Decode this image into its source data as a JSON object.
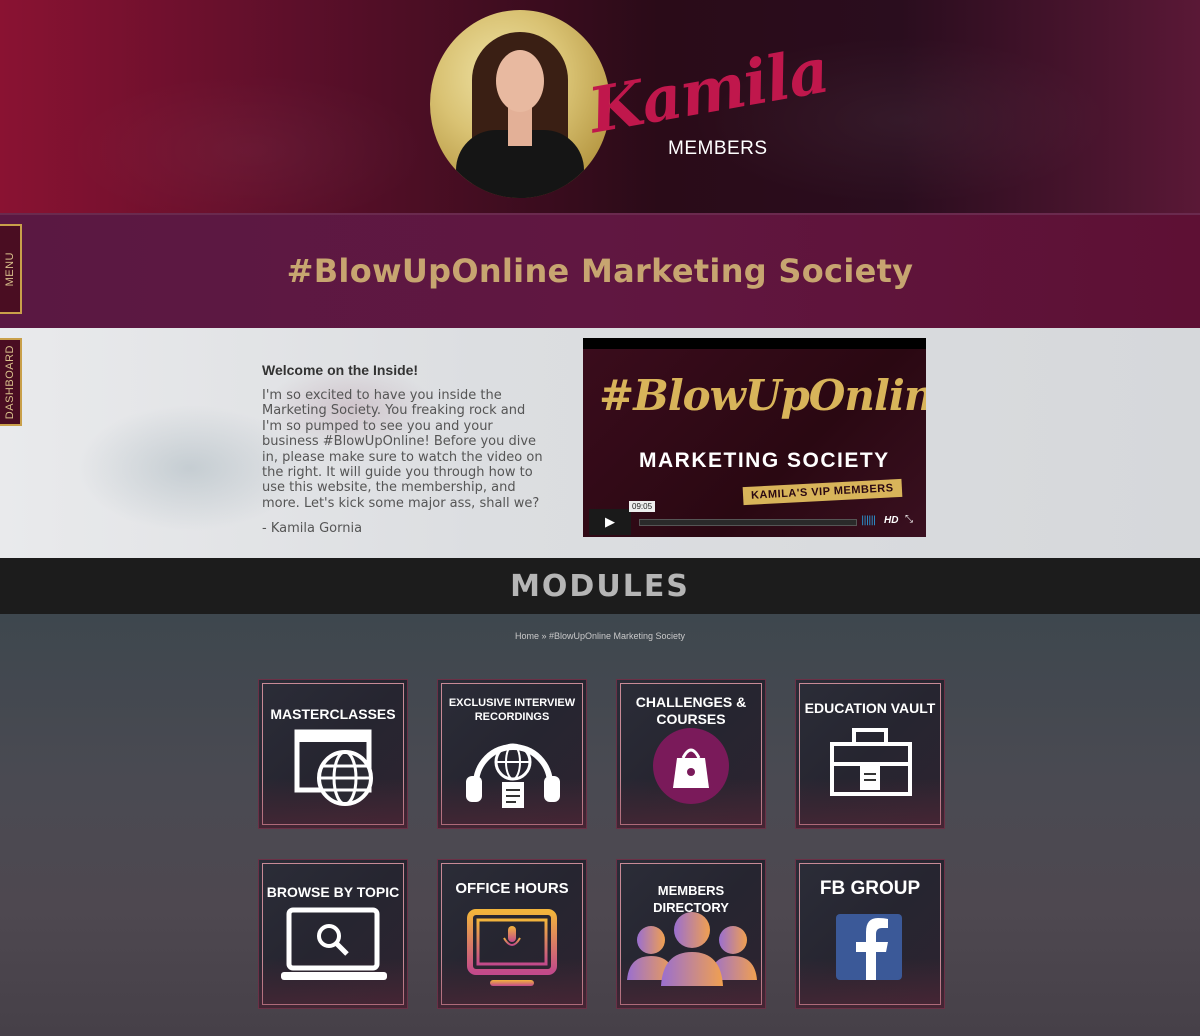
{
  "header": {
    "brand_script": "Kamila",
    "brand_sub": "MEMBERS"
  },
  "title_band": {
    "title": "#BlowUpOnline Marketing Society"
  },
  "side_tabs": {
    "menu": "MENU",
    "dashboard": "DASHBOARD"
  },
  "welcome": {
    "heading": "Welcome on the Inside!",
    "body": "I'm so excited to have you inside the Marketing Society. You freaking rock and I'm so pumped to see you and your business #BlowUpOnline! Before you dive in, please make sure to watch the video on the right. It will guide you through how to use this website, the membership, and more. Let's kick some major ass, shall we?",
    "signature": "- Kamila Gornia"
  },
  "video": {
    "script_title": "#BlowUpOnline",
    "subtitle": "MARKETING SOCIETY",
    "badge": "KAMILA'S VIP MEMBERS",
    "duration": "09:05",
    "hd_label": "HD"
  },
  "modules": {
    "title": "MODULES",
    "breadcrumb": "Home » #BlowUpOnline Marketing Society",
    "tiles": [
      {
        "label": "MASTERCLASSES",
        "icon": "browser-globe-icon"
      },
      {
        "label": "EXCLUSIVE INTERVIEW RECORDINGS",
        "icon": "headphones-globe-icon"
      },
      {
        "label": "CHALLENGES & COURSES",
        "icon": "shopping-bag-icon"
      },
      {
        "label": "EDUCATION VAULT",
        "icon": "briefcase-icon"
      },
      {
        "label": "BROWSE BY TOPIC",
        "icon": "laptop-search-icon"
      },
      {
        "label": "OFFICE HOURS",
        "icon": "monitor-microphone-icon"
      },
      {
        "label": "MEMBERS DIRECTORY",
        "icon": "people-group-icon"
      },
      {
        "label": "FB GROUP",
        "icon": "facebook-icon"
      }
    ]
  },
  "colors": {
    "gold": "#c7a570",
    "accent_magenta": "#c0174c",
    "facebook_blue": "#3b5998"
  }
}
